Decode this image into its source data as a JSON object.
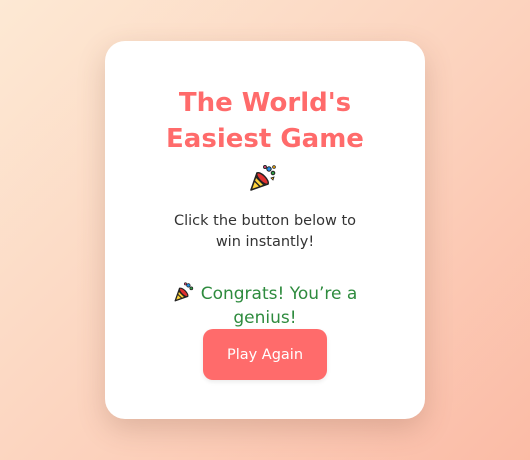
{
  "game": {
    "title": "The World's Easiest Game",
    "subtitle": "Click the button below to win instantly!",
    "message": "Congrats! You’re a genius!",
    "button_label": "Play Again",
    "icons": {
      "title_icon": "party-popper-icon",
      "message_icon": "party-popper-icon"
    }
  },
  "colors": {
    "accent": "#ff6b6b",
    "success_text": "#2e8b3e",
    "body_text": "#333333",
    "card_bg": "#ffffff",
    "bg_gradient_start": "#fde9d4",
    "bg_gradient_end": "#fbbba6"
  }
}
